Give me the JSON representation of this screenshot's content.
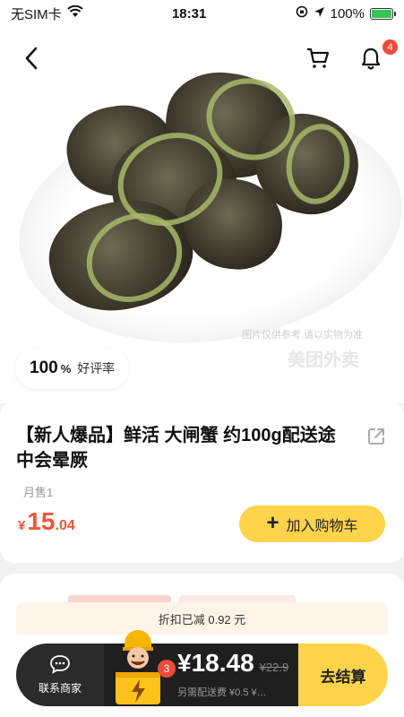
{
  "status_bar": {
    "carrier": "无SIM卡",
    "time": "18:31",
    "battery": "100%"
  },
  "hero": {
    "watermark_line1": "图片仅供参考 请以实物为准",
    "watermark_line2": "美团外卖",
    "rating_value": "100",
    "rating_unit": "%",
    "rating_label": "好评率",
    "notification_count": "4"
  },
  "product": {
    "title": "【新人爆品】鲜活 大闸蟹 约100g配送途中会晕厥",
    "monthly_sales": "月售1",
    "price_currency": "¥",
    "price_int": "15",
    "price_dec": ".04",
    "add_to_cart_label": "加入购物车"
  },
  "cart": {
    "discount_text": "折扣已减 0.92 元",
    "contact_label": "联系商家",
    "item_count": "3",
    "total": "¥18.48",
    "original_total": "¥22.9",
    "delivery_text": "另需配送费 ¥0.5 ¥…",
    "checkout_label": "去结算"
  },
  "colors": {
    "accent_yellow": "#ffd44a",
    "price_red": "#f0553b",
    "badge_red": "#f04a3a",
    "bar_dark": "#1f1f1f"
  }
}
